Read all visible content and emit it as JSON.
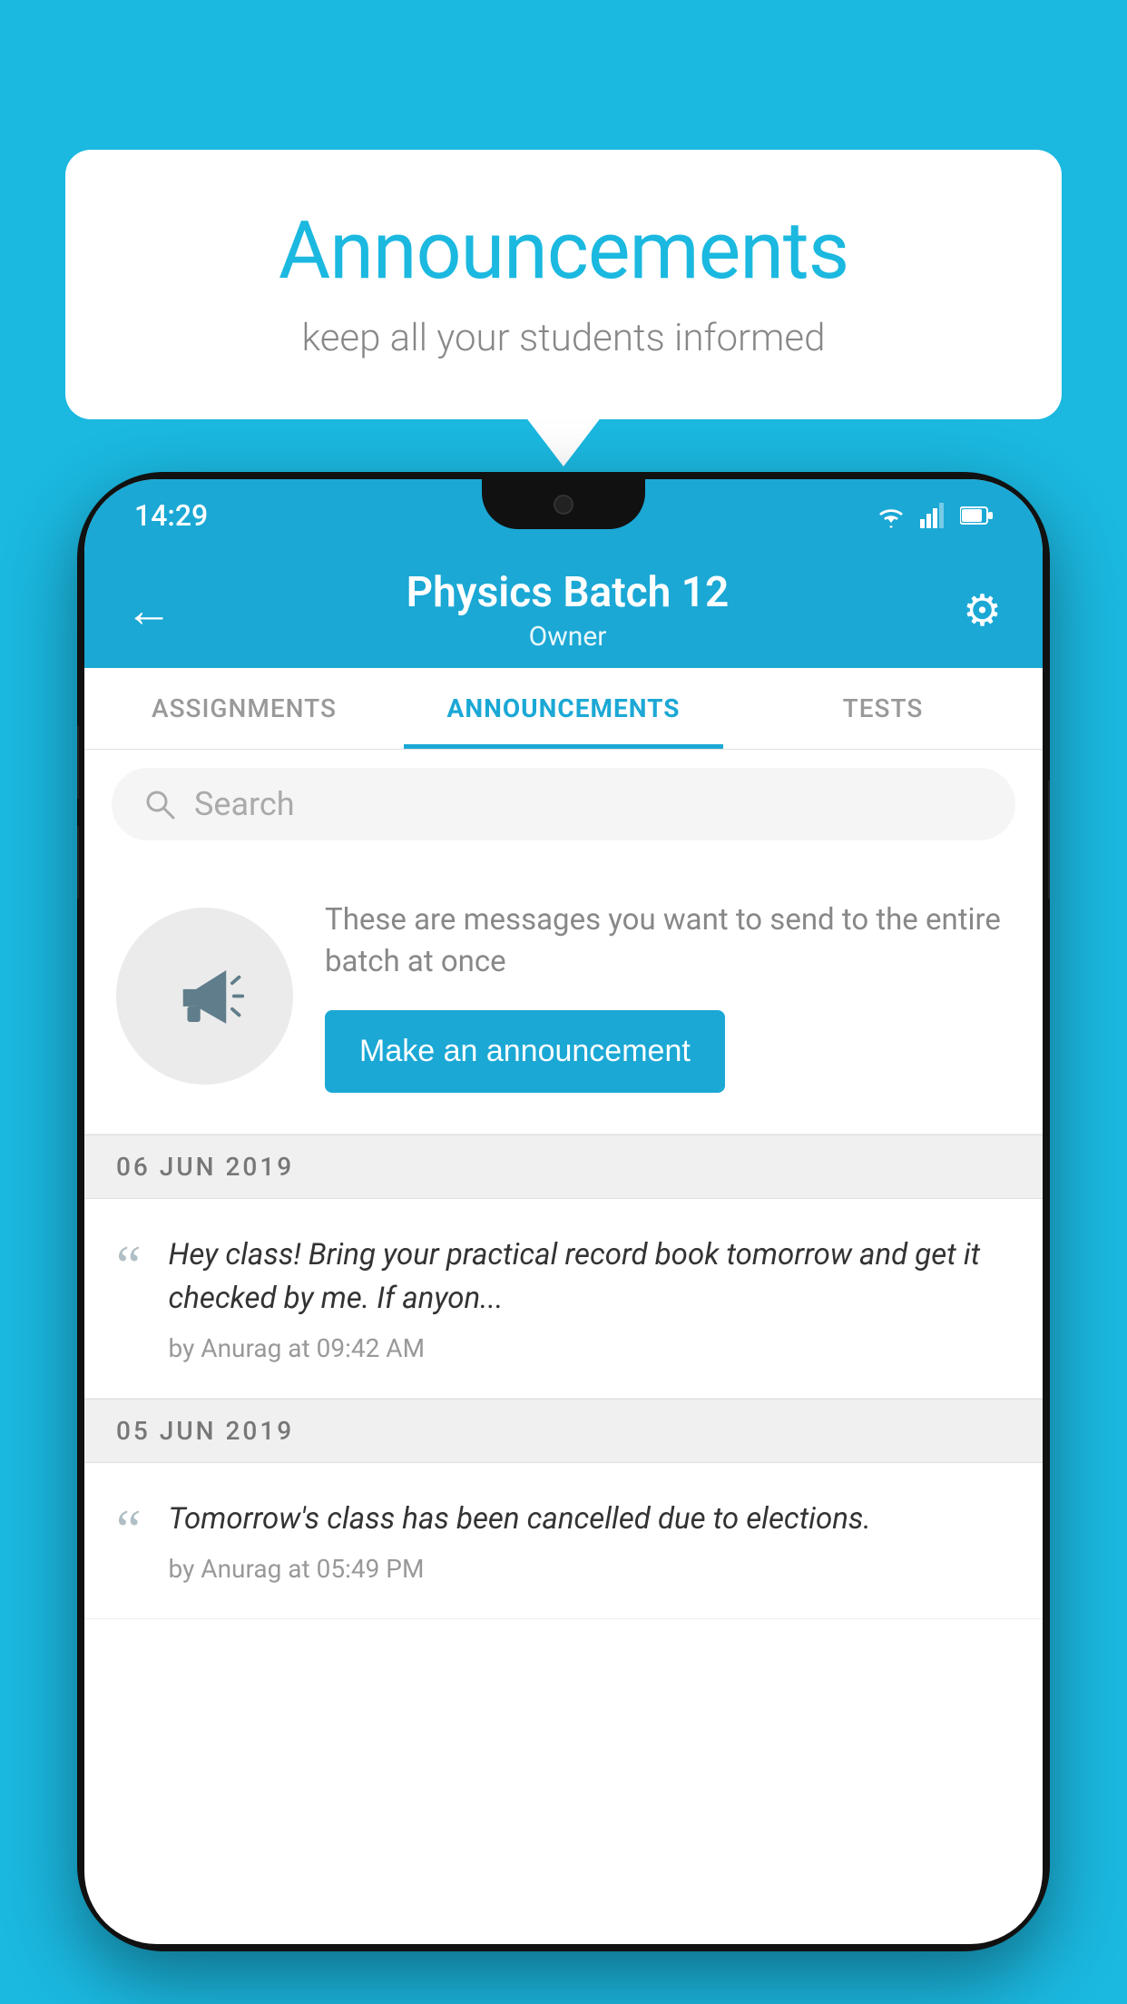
{
  "background_color": "#1bb8e0",
  "speech_bubble": {
    "title": "Announcements",
    "subtitle": "keep all your students informed"
  },
  "phone": {
    "status_bar": {
      "time": "14:29",
      "icons": [
        "wifi",
        "signal",
        "battery"
      ]
    },
    "header": {
      "title": "Physics Batch 12",
      "subtitle": "Owner",
      "back_label": "←",
      "gear_label": "⚙"
    },
    "tabs": [
      {
        "label": "ASSIGNMENTS",
        "active": false
      },
      {
        "label": "ANNOUNCEMENTS",
        "active": true
      },
      {
        "label": "TESTS",
        "active": false
      }
    ],
    "search": {
      "placeholder": "Search"
    },
    "announcement_prompt": {
      "description": "These are messages you want to send to the entire batch at once",
      "button_label": "Make an announcement"
    },
    "announcements": [
      {
        "date": "06  JUN  2019",
        "message": "Hey class! Bring your practical record book tomorrow and get it checked by me. If anyon...",
        "meta": "by Anurag at 09:42 AM"
      },
      {
        "date": "05  JUN  2019",
        "message": "Tomorrow's class has been cancelled due to elections.",
        "meta": "by Anurag at 05:49 PM"
      }
    ]
  }
}
